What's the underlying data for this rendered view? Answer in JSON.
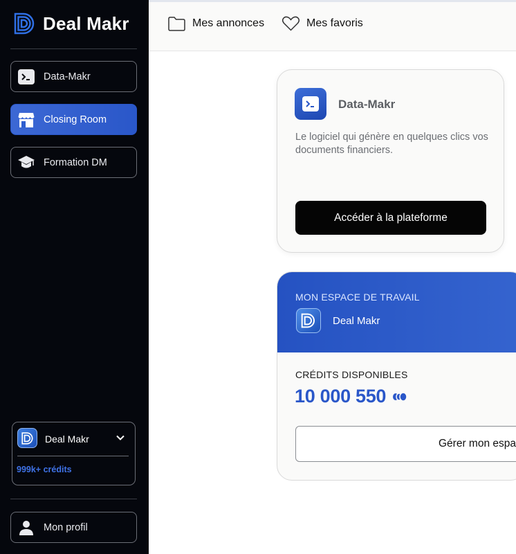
{
  "brand": {
    "name": "Deal Makr"
  },
  "sidebar": {
    "items": [
      {
        "label": "Data-Makr",
        "icon": "terminal-icon",
        "active": false
      },
      {
        "label": "Closing Room",
        "icon": "storefront-icon",
        "active": true
      },
      {
        "label": "Formation DM",
        "icon": "graduation-cap-icon",
        "active": false
      }
    ],
    "account": {
      "name": "Deal Makr",
      "credits": "999k+ crédits"
    },
    "profile": {
      "label": "Mon profil",
      "icon": "user-icon"
    }
  },
  "topbar": {
    "listings": {
      "label": "Mes annonces",
      "icon": "folder-icon"
    },
    "favorites": {
      "label": "Mes favoris",
      "icon": "heart-icon"
    }
  },
  "data_makr_card": {
    "title": "Data-Makr",
    "description": "Le logiciel qui génère en quelques clics vos documents financiers.",
    "button_label": "Accéder à la plateforme"
  },
  "workspace_card": {
    "section_label": "MON ESPACE DE TRAVAIL",
    "workspace_name": "Deal Makr",
    "credits_label": "CRÉDITS DISPONIBLES",
    "credits_value": "10 000 550",
    "button_label": "Gérer mon espace"
  },
  "colors": {
    "sidebar_bg": "#05070d",
    "accent_blue": "#2a57c9",
    "button_dark": "#050505"
  }
}
